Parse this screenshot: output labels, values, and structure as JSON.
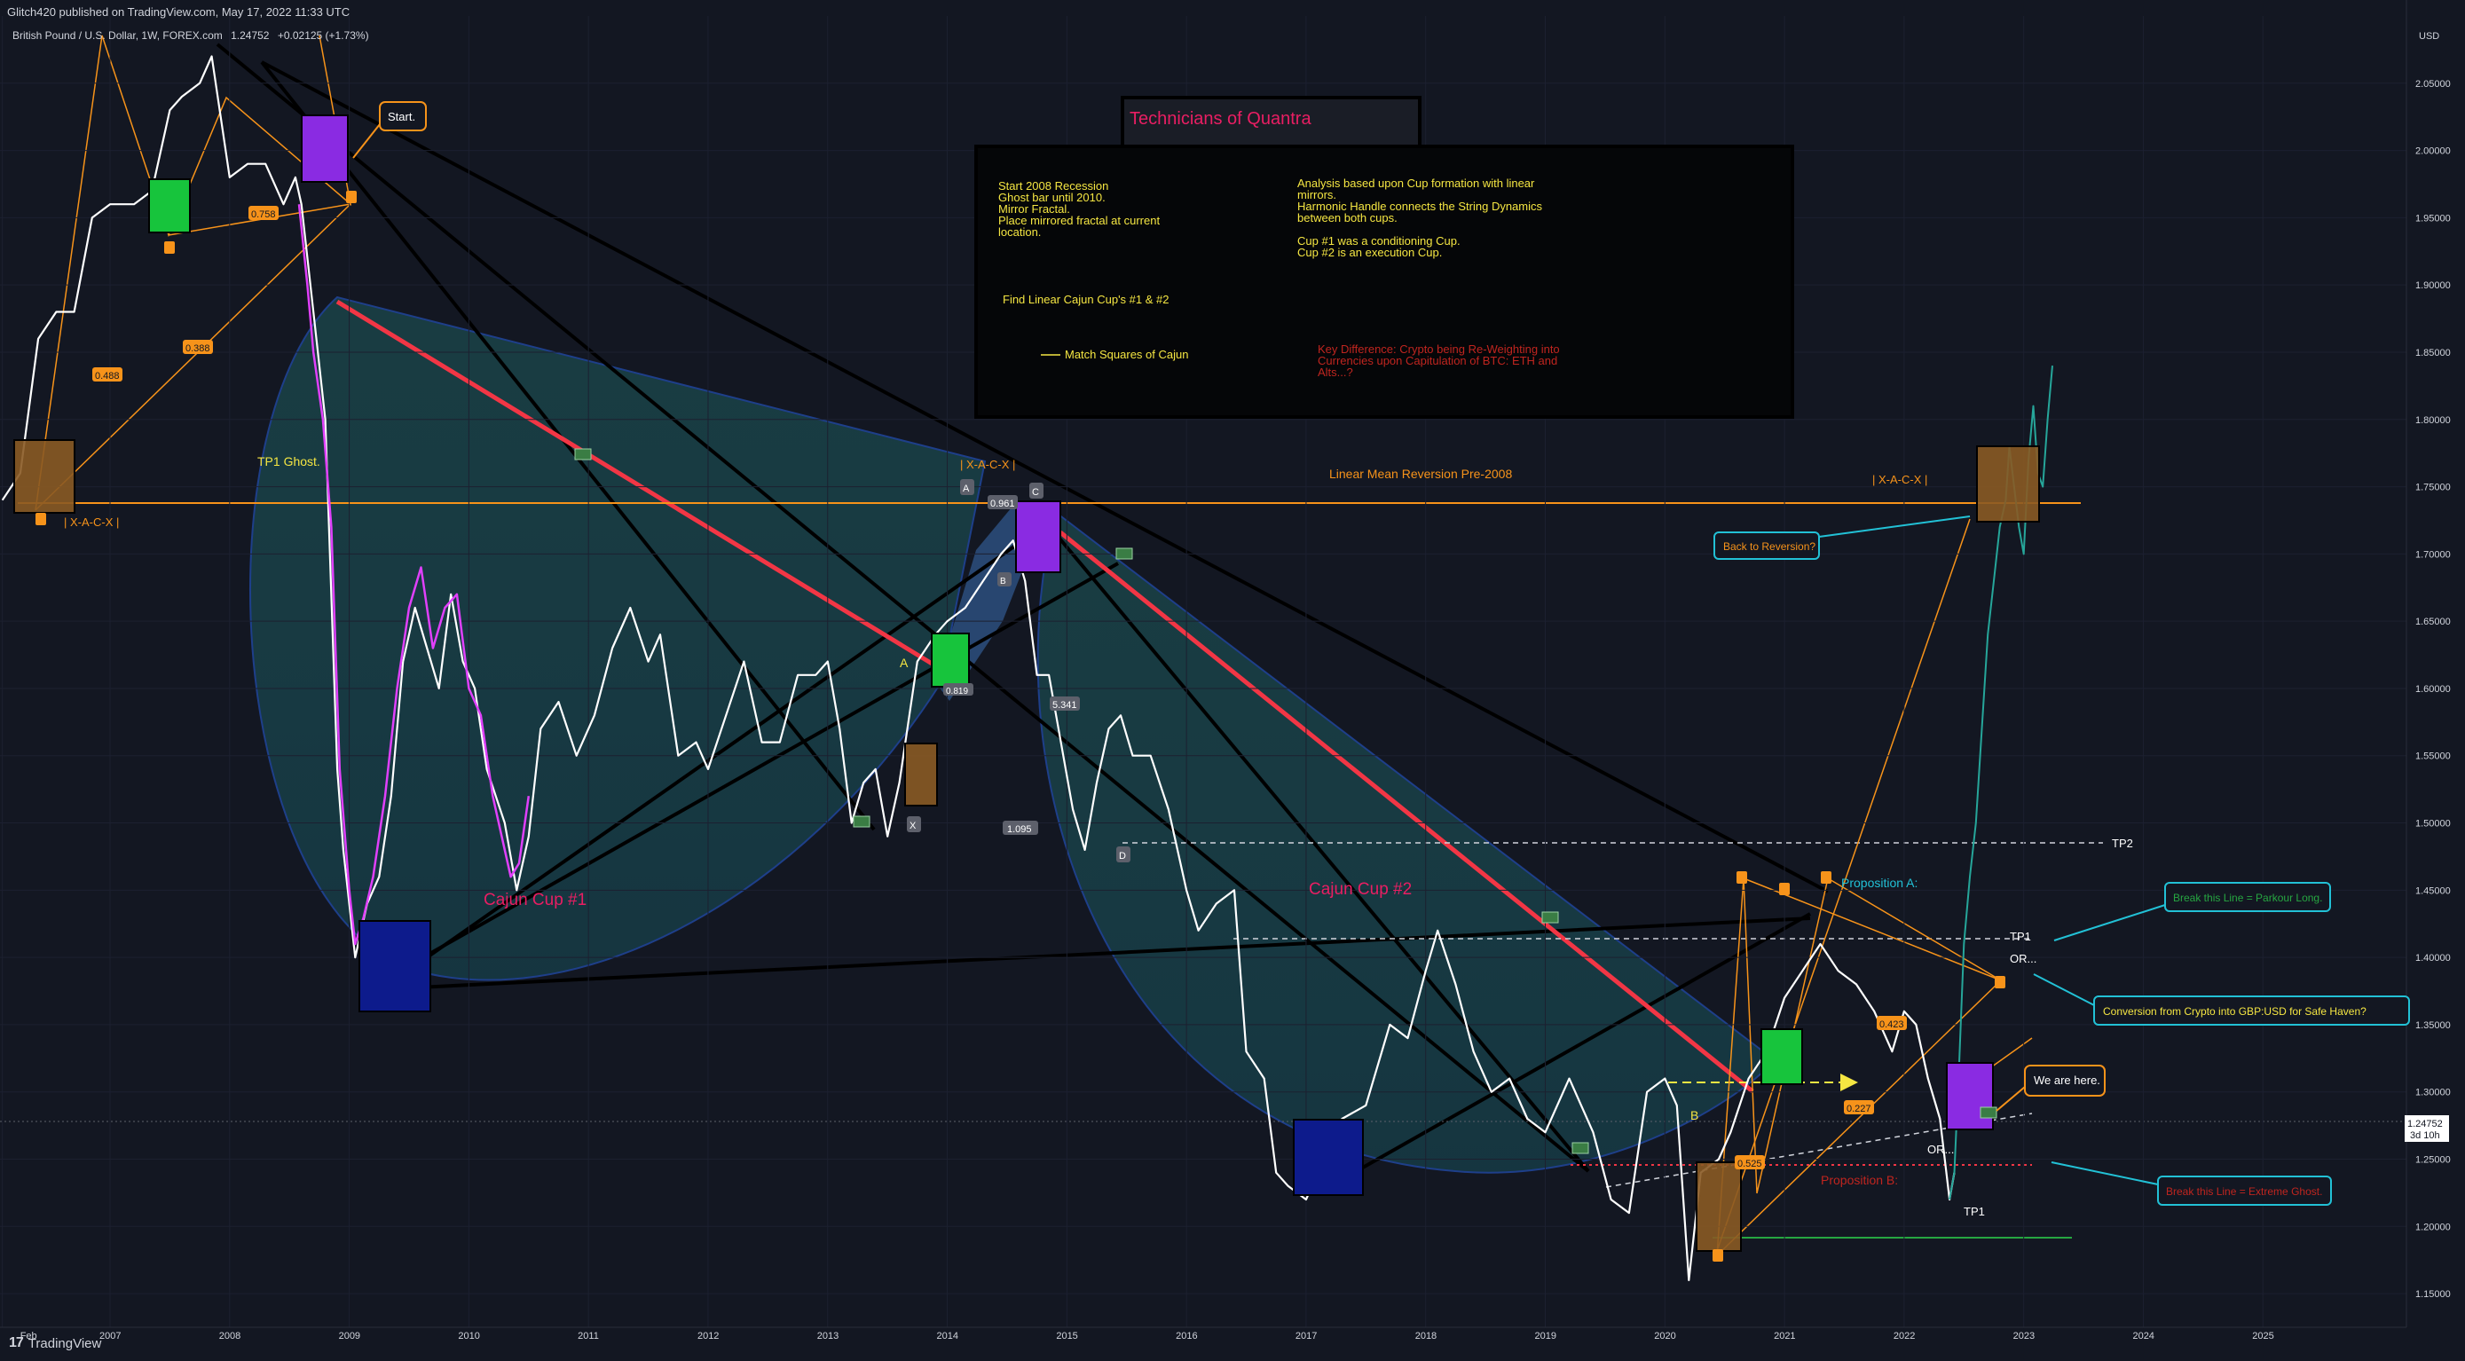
{
  "header": {
    "published": "Glitch420 published on TradingView.com, May 17, 2022 11:33 UTC",
    "symbol": "British Pound / U.S. Dollar, 1W, FOREX.com",
    "price": "1.24752",
    "change": "+0.02125 (+1.73%)"
  },
  "footer": {
    "brand": "TradingView",
    "logo_mark": "17"
  },
  "colors": {
    "background": "#131722",
    "price_line": "#ffffff",
    "magenta": "#e040fb",
    "teal_projection": "#26a69a",
    "cup_fill": "#1a4a4e",
    "red_trend": "#f23645",
    "orange": "#f7931a",
    "yellow_text": "#f5e642",
    "pink_title": "#e91e63",
    "cyan": "#22c1d6",
    "green_box": "#17c43c",
    "purple_box": "#8a2be2",
    "navy_box": "#0d1b8c",
    "brown_box": "#8a5a24"
  },
  "chart_data": {
    "type": "line",
    "title": "Technicians of Quantra",
    "currency": "USD",
    "ylim": [
      1.125,
      2.1
    ],
    "xlim": [
      2006.08,
      2026.2
    ],
    "x_tick_labels": [
      "Feb",
      "2007",
      "2008",
      "2009",
      "2010",
      "2011",
      "2012",
      "2013",
      "2014",
      "2015",
      "2016",
      "2017",
      "2018",
      "2019",
      "2020",
      "2021",
      "2022",
      "2023",
      "2024",
      "2025"
    ],
    "x_ticks": [
      2006.1,
      2007,
      2008,
      2009,
      2010,
      2011,
      2012,
      2013,
      2014,
      2015,
      2016,
      2017,
      2018,
      2019,
      2020,
      2021,
      2022,
      2023,
      2024,
      2025
    ],
    "y_tick_labels": [
      "2.05000",
      "2.00000",
      "1.95000",
      "1.90000",
      "1.85000",
      "1.80000",
      "1.75000",
      "1.70000",
      "1.65000",
      "1.60000",
      "1.55000",
      "1.50000",
      "1.45000",
      "1.40000",
      "1.35000",
      "1.30000",
      "1.25000",
      "1.20000",
      "1.15000"
    ],
    "y_ticks": [
      2.05,
      2.0,
      1.95,
      1.9,
      1.85,
      1.8,
      1.75,
      1.7,
      1.65,
      1.6,
      1.55,
      1.5,
      1.45,
      1.4,
      1.35,
      1.3,
      1.25,
      1.2,
      1.15
    ],
    "last_price": {
      "value": 1.24752,
      "label": "1.24752",
      "countdown": "3d 10h"
    },
    "series": [
      {
        "key": "gbpusd",
        "points": [
          [
            2006.1,
            1.74
          ],
          [
            2006.25,
            1.76
          ],
          [
            2006.4,
            1.86
          ],
          [
            2006.55,
            1.88
          ],
          [
            2006.7,
            1.88
          ],
          [
            2006.85,
            1.95
          ],
          [
            2007.0,
            1.96
          ],
          [
            2007.2,
            1.96
          ],
          [
            2007.35,
            1.97
          ],
          [
            2007.5,
            2.03
          ],
          [
            2007.6,
            2.04
          ],
          [
            2007.75,
            2.05
          ],
          [
            2007.85,
            2.07
          ],
          [
            2008.0,
            1.98
          ],
          [
            2008.15,
            1.99
          ],
          [
            2008.3,
            1.99
          ],
          [
            2008.45,
            1.96
          ],
          [
            2008.55,
            1.98
          ],
          [
            2008.6,
            1.96
          ],
          [
            2008.7,
            1.88
          ],
          [
            2008.8,
            1.8
          ],
          [
            2008.9,
            1.54
          ],
          [
            2008.95,
            1.48
          ],
          [
            2009.05,
            1.4
          ],
          [
            2009.15,
            1.44
          ],
          [
            2009.25,
            1.46
          ],
          [
            2009.35,
            1.52
          ],
          [
            2009.45,
            1.62
          ],
          [
            2009.55,
            1.66
          ],
          [
            2009.65,
            1.63
          ],
          [
            2009.75,
            1.6
          ],
          [
            2009.85,
            1.67
          ],
          [
            2009.95,
            1.62
          ],
          [
            2010.05,
            1.6
          ],
          [
            2010.15,
            1.54
          ],
          [
            2010.3,
            1.5
          ],
          [
            2010.4,
            1.45
          ],
          [
            2010.5,
            1.49
          ],
          [
            2010.6,
            1.57
          ],
          [
            2010.75,
            1.59
          ],
          [
            2010.9,
            1.55
          ],
          [
            2011.05,
            1.58
          ],
          [
            2011.2,
            1.63
          ],
          [
            2011.35,
            1.66
          ],
          [
            2011.5,
            1.62
          ],
          [
            2011.6,
            1.64
          ],
          [
            2011.75,
            1.55
          ],
          [
            2011.9,
            1.56
          ],
          [
            2012.0,
            1.54
          ],
          [
            2012.15,
            1.58
          ],
          [
            2012.3,
            1.62
          ],
          [
            2012.45,
            1.56
          ],
          [
            2012.6,
            1.56
          ],
          [
            2012.75,
            1.61
          ],
          [
            2012.9,
            1.61
          ],
          [
            2013.0,
            1.62
          ],
          [
            2013.1,
            1.57
          ],
          [
            2013.2,
            1.5
          ],
          [
            2013.3,
            1.53
          ],
          [
            2013.4,
            1.54
          ],
          [
            2013.5,
            1.49
          ],
          [
            2013.6,
            1.53
          ],
          [
            2013.75,
            1.62
          ],
          [
            2013.9,
            1.64
          ],
          [
            2014.0,
            1.65
          ],
          [
            2014.15,
            1.66
          ],
          [
            2014.3,
            1.68
          ],
          [
            2014.45,
            1.7
          ],
          [
            2014.55,
            1.71
          ],
          [
            2014.65,
            1.68
          ],
          [
            2014.75,
            1.61
          ],
          [
            2014.85,
            1.61
          ],
          [
            2014.95,
            1.56
          ],
          [
            2015.05,
            1.51
          ],
          [
            2015.15,
            1.48
          ],
          [
            2015.25,
            1.53
          ],
          [
            2015.35,
            1.57
          ],
          [
            2015.45,
            1.58
          ],
          [
            2015.55,
            1.55
          ],
          [
            2015.7,
            1.55
          ],
          [
            2015.85,
            1.51
          ],
          [
            2016.0,
            1.45
          ],
          [
            2016.1,
            1.42
          ],
          [
            2016.25,
            1.44
          ],
          [
            2016.4,
            1.45
          ],
          [
            2016.5,
            1.33
          ],
          [
            2016.65,
            1.31
          ],
          [
            2016.75,
            1.24
          ],
          [
            2016.85,
            1.23
          ],
          [
            2017.0,
            1.22
          ],
          [
            2017.15,
            1.25
          ],
          [
            2017.3,
            1.28
          ],
          [
            2017.5,
            1.29
          ],
          [
            2017.7,
            1.35
          ],
          [
            2017.85,
            1.34
          ],
          [
            2018.0,
            1.39
          ],
          [
            2018.1,
            1.42
          ],
          [
            2018.25,
            1.38
          ],
          [
            2018.4,
            1.33
          ],
          [
            2018.55,
            1.3
          ],
          [
            2018.7,
            1.31
          ],
          [
            2018.85,
            1.28
          ],
          [
            2019.0,
            1.27
          ],
          [
            2019.2,
            1.31
          ],
          [
            2019.4,
            1.27
          ],
          [
            2019.55,
            1.22
          ],
          [
            2019.7,
            1.21
          ],
          [
            2019.85,
            1.3
          ],
          [
            2020.0,
            1.31
          ],
          [
            2020.1,
            1.29
          ],
          [
            2020.2,
            1.16
          ],
          [
            2020.3,
            1.24
          ],
          [
            2020.45,
            1.25
          ],
          [
            2020.55,
            1.27
          ],
          [
            2020.7,
            1.31
          ],
          [
            2020.85,
            1.33
          ],
          [
            2021.0,
            1.37
          ],
          [
            2021.15,
            1.39
          ],
          [
            2021.3,
            1.41
          ],
          [
            2021.45,
            1.39
          ],
          [
            2021.6,
            1.38
          ],
          [
            2021.75,
            1.36
          ],
          [
            2021.9,
            1.33
          ],
          [
            2022.0,
            1.36
          ],
          [
            2022.1,
            1.35
          ],
          [
            2022.2,
            1.31
          ],
          [
            2022.3,
            1.28
          ],
          [
            2022.38,
            1.22
          ],
          [
            2022.42,
            1.24
          ]
        ]
      },
      {
        "key": "magenta_fractal",
        "points": [
          [
            2008.58,
            1.96
          ],
          [
            2008.65,
            1.9
          ],
          [
            2008.7,
            1.85
          ],
          [
            2008.78,
            1.8
          ],
          [
            2008.85,
            1.72
          ],
          [
            2008.92,
            1.54
          ],
          [
            2009.0,
            1.45
          ],
          [
            2009.05,
            1.41
          ],
          [
            2009.12,
            1.43
          ],
          [
            2009.2,
            1.46
          ],
          [
            2009.3,
            1.52
          ],
          [
            2009.4,
            1.6
          ],
          [
            2009.5,
            1.66
          ],
          [
            2009.6,
            1.69
          ],
          [
            2009.7,
            1.63
          ],
          [
            2009.8,
            1.66
          ],
          [
            2009.9,
            1.67
          ],
          [
            2010.0,
            1.6
          ],
          [
            2010.1,
            1.58
          ],
          [
            2010.2,
            1.52
          ],
          [
            2010.3,
            1.48
          ],
          [
            2010.35,
            1.46
          ],
          [
            2010.42,
            1.47
          ],
          [
            2010.5,
            1.52
          ]
        ]
      },
      {
        "key": "teal_projection",
        "points": [
          [
            2022.38,
            1.22
          ],
          [
            2022.42,
            1.24
          ],
          [
            2022.46,
            1.32
          ],
          [
            2022.5,
            1.41
          ],
          [
            2022.55,
            1.46
          ],
          [
            2022.6,
            1.5
          ],
          [
            2022.65,
            1.57
          ],
          [
            2022.7,
            1.64
          ],
          [
            2022.75,
            1.68
          ],
          [
            2022.8,
            1.72
          ],
          [
            2022.85,
            1.74
          ],
          [
            2022.88,
            1.78
          ],
          [
            2022.92,
            1.75
          ],
          [
            2022.96,
            1.72
          ],
          [
            2023.0,
            1.7
          ],
          [
            2023.04,
            1.77
          ],
          [
            2023.08,
            1.81
          ],
          [
            2023.12,
            1.76
          ],
          [
            2023.16,
            1.75
          ],
          [
            2023.2,
            1.8
          ],
          [
            2023.24,
            1.84
          ]
        ]
      }
    ]
  },
  "annotations": {
    "title_box": "Technicians of Quantra",
    "note_left": [
      "Start 2008 Recession",
      "Ghost bar until 2010.",
      "Mirror Fractal.",
      "Place mirrored fractal at current",
      "location."
    ],
    "note_right": [
      "Analysis based upon Cup formation with linear",
      "mirrors.",
      "Harmonic Handle connects the String Dynamics",
      "between both cups.",
      "",
      "Cup #1 was a conditioning Cup.",
      "Cup #2 is an execution Cup."
    ],
    "find_cups": "Find Linear Cajun Cup's #1 & #2",
    "match_squares": "Match Squares of Cajun",
    "key_difference": [
      "Key Difference: Crypto being  Re-Weighting into",
      "Currencies upon Capitulation of BTC: ETH and",
      "Alts...?"
    ],
    "start": "Start.",
    "tp1_ghost": "TP1 Ghost.",
    "xacx_1": "| X-A-C-X |",
    "xacx_2": "| X-A-C-X |",
    "xacx_3": "| X-A-C-X |",
    "linear_mean": "Linear Mean Reversion Pre-2008",
    "back_to_reversion": "Back to Reversion?",
    "cajun_cup_1": "Cajun Cup #1",
    "cajun_cup_2": "Cajun Cup #2",
    "proposition_a": "Proposition A:",
    "proposition_b": "Proposition B:",
    "break_parkour": "Break this Line = Parkour Long.",
    "conversion": "Conversion from Crypto into GBP:USD for Safe Haven?",
    "we_are_here": "We are here.",
    "break_ghost": "Break this Line = Extreme Ghost.",
    "tp2": "TP2",
    "tp1": "TP1",
    "tp1_low": "TP1",
    "or_1": "OR...",
    "or_2": "OR...",
    "pt_a": "A",
    "pt_b": "B",
    "pt_c": "C",
    "pt_d": "D",
    "pt_x": "X",
    "pt_a_yellow": "A",
    "pt_b_yellow": "B",
    "val_0961": "0.961",
    "val_5341": "5.341",
    "val_1095": "1.095",
    "val_0819": "0.819",
    "val_0488": "0.488",
    "val_0388": "0.388",
    "val_0758": "0.758",
    "val_0423": "0.423",
    "val_0227": "0.227",
    "val_0525": "0.525"
  }
}
